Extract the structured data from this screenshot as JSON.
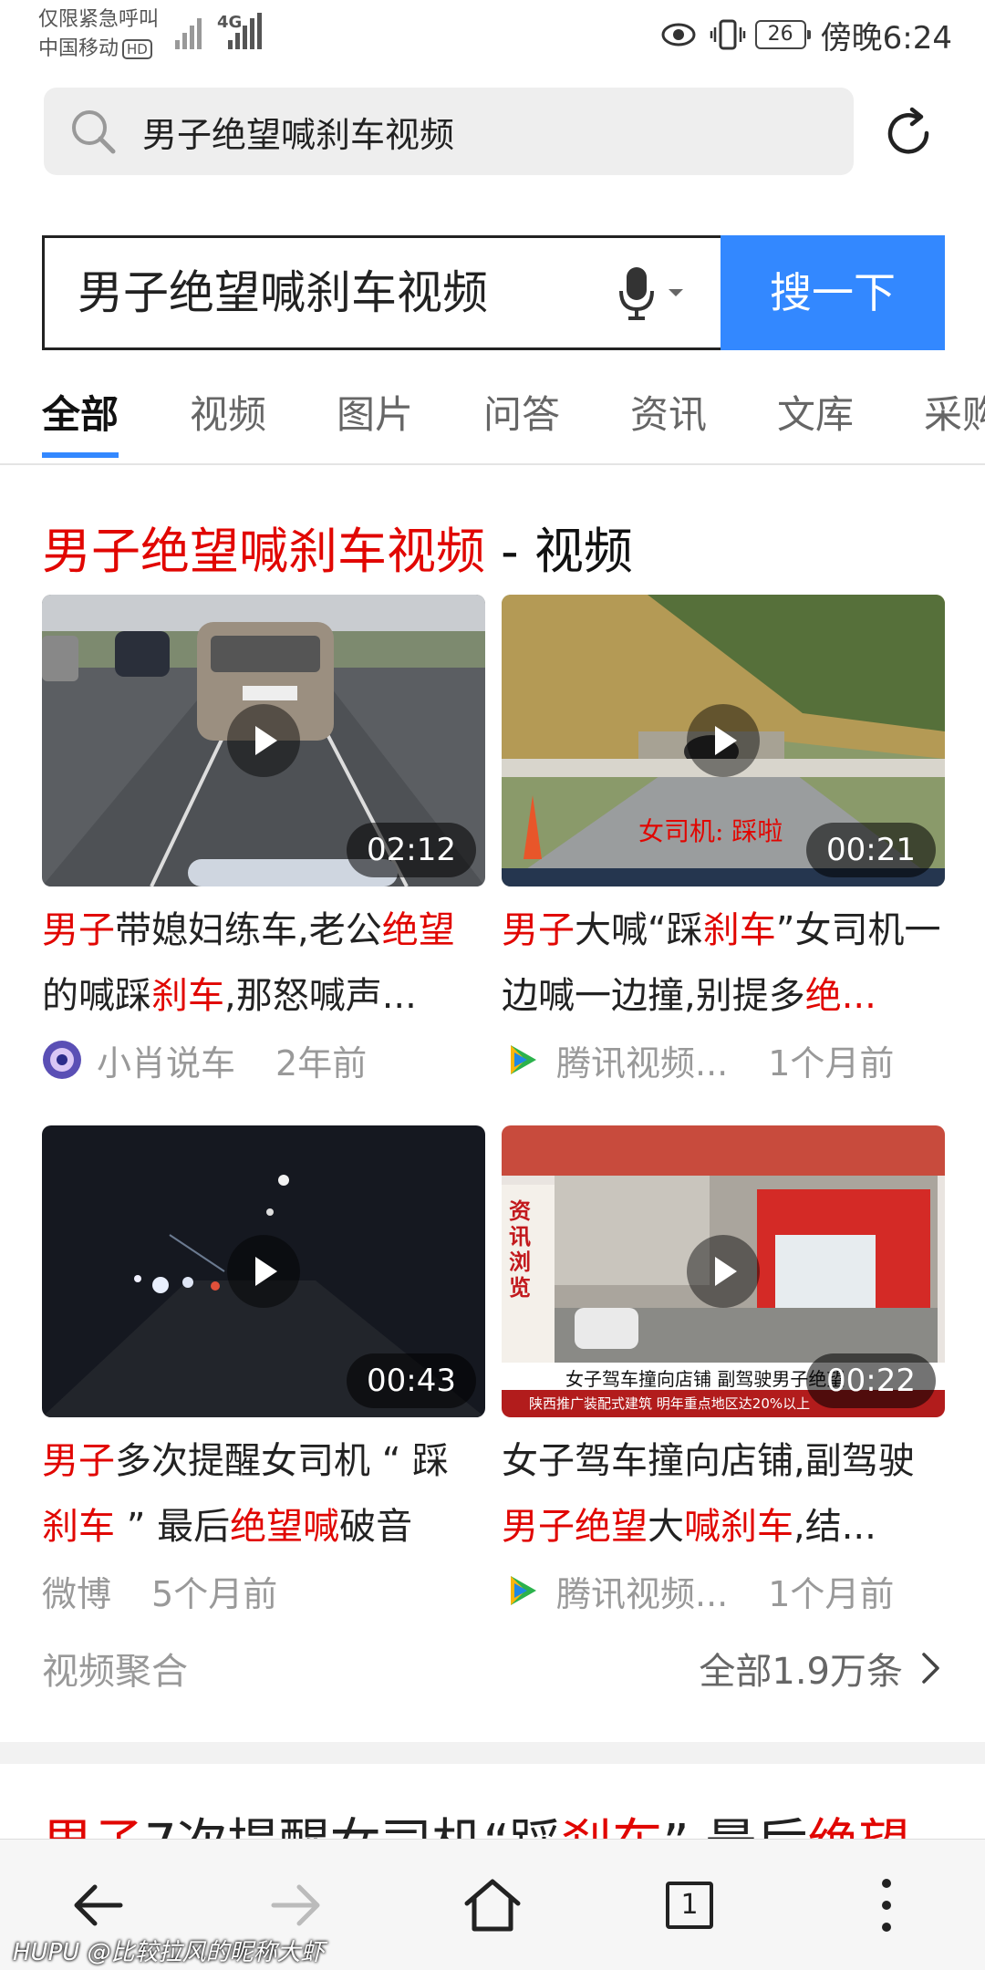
{
  "status_bar": {
    "line1": "仅限紧急呼叫",
    "line2": "中国移动",
    "hd": "HD",
    "network": "4G",
    "battery": "26",
    "time": "傍晚6:24"
  },
  "top_search": {
    "query": "男子绝望喊刹车视频"
  },
  "search_box": {
    "query": "男子绝望喊刹车视频",
    "button": "搜一下"
  },
  "tabs": [
    "全部",
    "视频",
    "图片",
    "问答",
    "资讯",
    "文库",
    "采购"
  ],
  "section": {
    "title_highlight": "男子绝望喊刹车视频",
    "title_suffix": " - 视频"
  },
  "videos": [
    {
      "duration": "02:12",
      "title_parts": [
        {
          "t": "男子",
          "red": true
        },
        {
          "t": "带媳妇练车,老公",
          "red": false
        },
        {
          "t": "绝望",
          "red": true
        },
        {
          "t": "的喊踩",
          "red": false
        },
        {
          "t": "刹车",
          "red": true
        },
        {
          "t": ",那怒喊声...",
          "red": false
        }
      ],
      "source": "小肖说车",
      "source_icon": "avatar-icon",
      "time": "2年前"
    },
    {
      "duration": "00:21",
      "overlay_text": "女司机: 踩啦",
      "title_parts": [
        {
          "t": "男子",
          "red": true
        },
        {
          "t": "大喊“踩",
          "red": false
        },
        {
          "t": "刹车",
          "red": true
        },
        {
          "t": "”女司机一边喊一边撞,别提多",
          "red": false
        },
        {
          "t": "绝...",
          "red": true
        }
      ],
      "source": "腾讯视频...",
      "source_icon": "tencent-video-icon",
      "time": "1个月前"
    },
    {
      "duration": "00:43",
      "title_parts": [
        {
          "t": "男子",
          "red": true
        },
        {
          "t": "多次提醒女司机 “ 踩",
          "red": false
        },
        {
          "t": "刹车",
          "red": true
        },
        {
          "t": " ” 最后",
          "red": false
        },
        {
          "t": "绝望喊",
          "red": true
        },
        {
          "t": "破音",
          "red": false
        }
      ],
      "source": "微博",
      "source_icon": "",
      "time": "5个月前"
    },
    {
      "duration": "00:22",
      "caption": "女子驾车撞向店铺 副驾驶男子绝望",
      "ticker": "陕西推广装配式建筑 明年重点地区达20%以上",
      "side_label": "资讯浏览",
      "title_parts": [
        {
          "t": "女子驾车撞向店铺,副驾驶",
          "red": false
        },
        {
          "t": "男子绝望",
          "red": true
        },
        {
          "t": "大",
          "red": false
        },
        {
          "t": "喊刹车",
          "red": true
        },
        {
          "t": ",结...",
          "red": false
        }
      ],
      "source": "腾讯视频...",
      "source_icon": "tencent-video-icon",
      "time": "1个月前"
    }
  ],
  "footer": {
    "aggregate": "视频聚合",
    "all_count": "全部1.9万条"
  },
  "next_result": {
    "parts": [
      {
        "t": "男子",
        "red": true
      },
      {
        "t": "7次提醒女司机“踩",
        "red": false
      },
      {
        "t": "刹车",
        "red": true
      },
      {
        "t": "” 最后",
        "red": false
      },
      {
        "t": "绝望",
        "red": true
      }
    ]
  },
  "bottom_nav": {
    "tab_count": "1"
  },
  "watermark": "HUPU @比较拉风的昵称大虾"
}
